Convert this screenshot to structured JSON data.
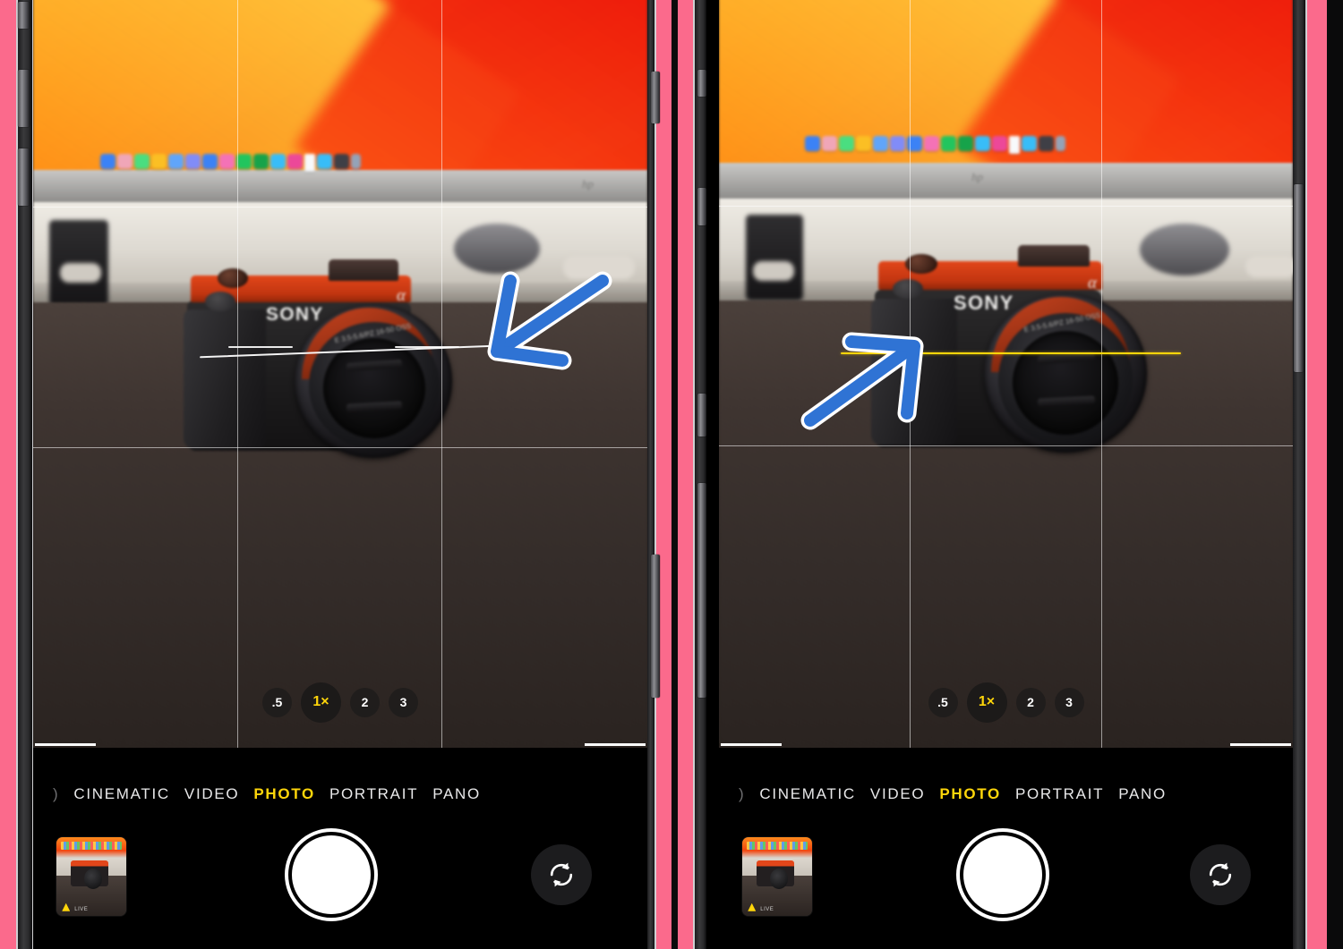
{
  "meta": {
    "description": "Side-by-side iPhone Camera app screenshots demonstrating the Level feature, left phone tilted (white level line offset) and right phone level (yellow aligned line)",
    "device_frame_color": "#fb6a8c",
    "accent_yellow": "#ffd60a",
    "annotation_blue": "#2f73d4",
    "annotation_outline": "#ffffff"
  },
  "phones": [
    {
      "id": "left",
      "level": {
        "state": "not-level",
        "reference_label": "horizon-reference-line",
        "tilt_label": "tilted-level-line",
        "color": "#ffffff",
        "tilt_degrees": -2.2
      },
      "annotation": {
        "name": "arrow-pointing-down-left",
        "direction": "down-left"
      },
      "zoom_options": [
        {
          "label": ".5",
          "selected": false
        },
        {
          "label": "1×",
          "selected": true
        },
        {
          "label": "2",
          "selected": false
        },
        {
          "label": "3",
          "selected": false
        }
      ],
      "modes": [
        {
          "label": "CINEMATIC",
          "selected": false
        },
        {
          "label": "VIDEO",
          "selected": false
        },
        {
          "label": "PHOTO",
          "selected": true
        },
        {
          "label": "PORTRAIT",
          "selected": false
        },
        {
          "label": "PANO",
          "selected": false
        }
      ],
      "controls": {
        "thumbnail_label": "last-photo-thumbnail",
        "thumbnail_caption": "LIVE",
        "shutter_label": "shutter-button",
        "flip_label": "flip-camera-button"
      },
      "scene": {
        "subject_brand": "SONY",
        "subject_model_mark": "α",
        "lens_text": "E 3.5-5.6/PZ 16-50 OSS",
        "monitor_logo": "hp",
        "dock_app_colors": [
          "#3b82f6",
          "#f0a6b8",
          "#4ade80",
          "#fbbf24",
          "#60a5fa",
          "#818cf8",
          "#3b82f6",
          "#f472b6",
          "#22c55e",
          "#16a34a",
          "#38bdf8",
          "#ec4899",
          "#f8fafc",
          "#38bdf8",
          "#64748b"
        ]
      }
    },
    {
      "id": "right",
      "level": {
        "state": "level",
        "reference_label": "horizon-reference-line",
        "tilt_label": "aligned-level-line",
        "color": "#ffd60a",
        "tilt_degrees": 0
      },
      "annotation": {
        "name": "arrow-pointing-up-right",
        "direction": "up-right"
      },
      "zoom_options": [
        {
          "label": ".5",
          "selected": false
        },
        {
          "label": "1×",
          "selected": true
        },
        {
          "label": "2",
          "selected": false
        },
        {
          "label": "3",
          "selected": false
        }
      ],
      "modes": [
        {
          "label": "CINEMATIC",
          "selected": false
        },
        {
          "label": "VIDEO",
          "selected": false
        },
        {
          "label": "PHOTO",
          "selected": true
        },
        {
          "label": "PORTRAIT",
          "selected": false
        },
        {
          "label": "PANO",
          "selected": false
        }
      ],
      "controls": {
        "thumbnail_label": "last-photo-thumbnail",
        "thumbnail_caption": "LIVE",
        "shutter_label": "shutter-button",
        "flip_label": "flip-camera-button"
      },
      "scene": {
        "subject_brand": "SONY",
        "subject_model_mark": "α",
        "lens_text": "E 3.5-5.6/PZ 16-50 OSS",
        "monitor_logo": "hp",
        "dock_app_colors": [
          "#3b82f6",
          "#f0a6b8",
          "#4ade80",
          "#fbbf24",
          "#60a5fa",
          "#818cf8",
          "#3b82f6",
          "#f472b6",
          "#22c55e",
          "#16a34a",
          "#38bdf8",
          "#ec4899",
          "#f8fafc",
          "#38bdf8",
          "#64748b"
        ]
      }
    }
  ]
}
